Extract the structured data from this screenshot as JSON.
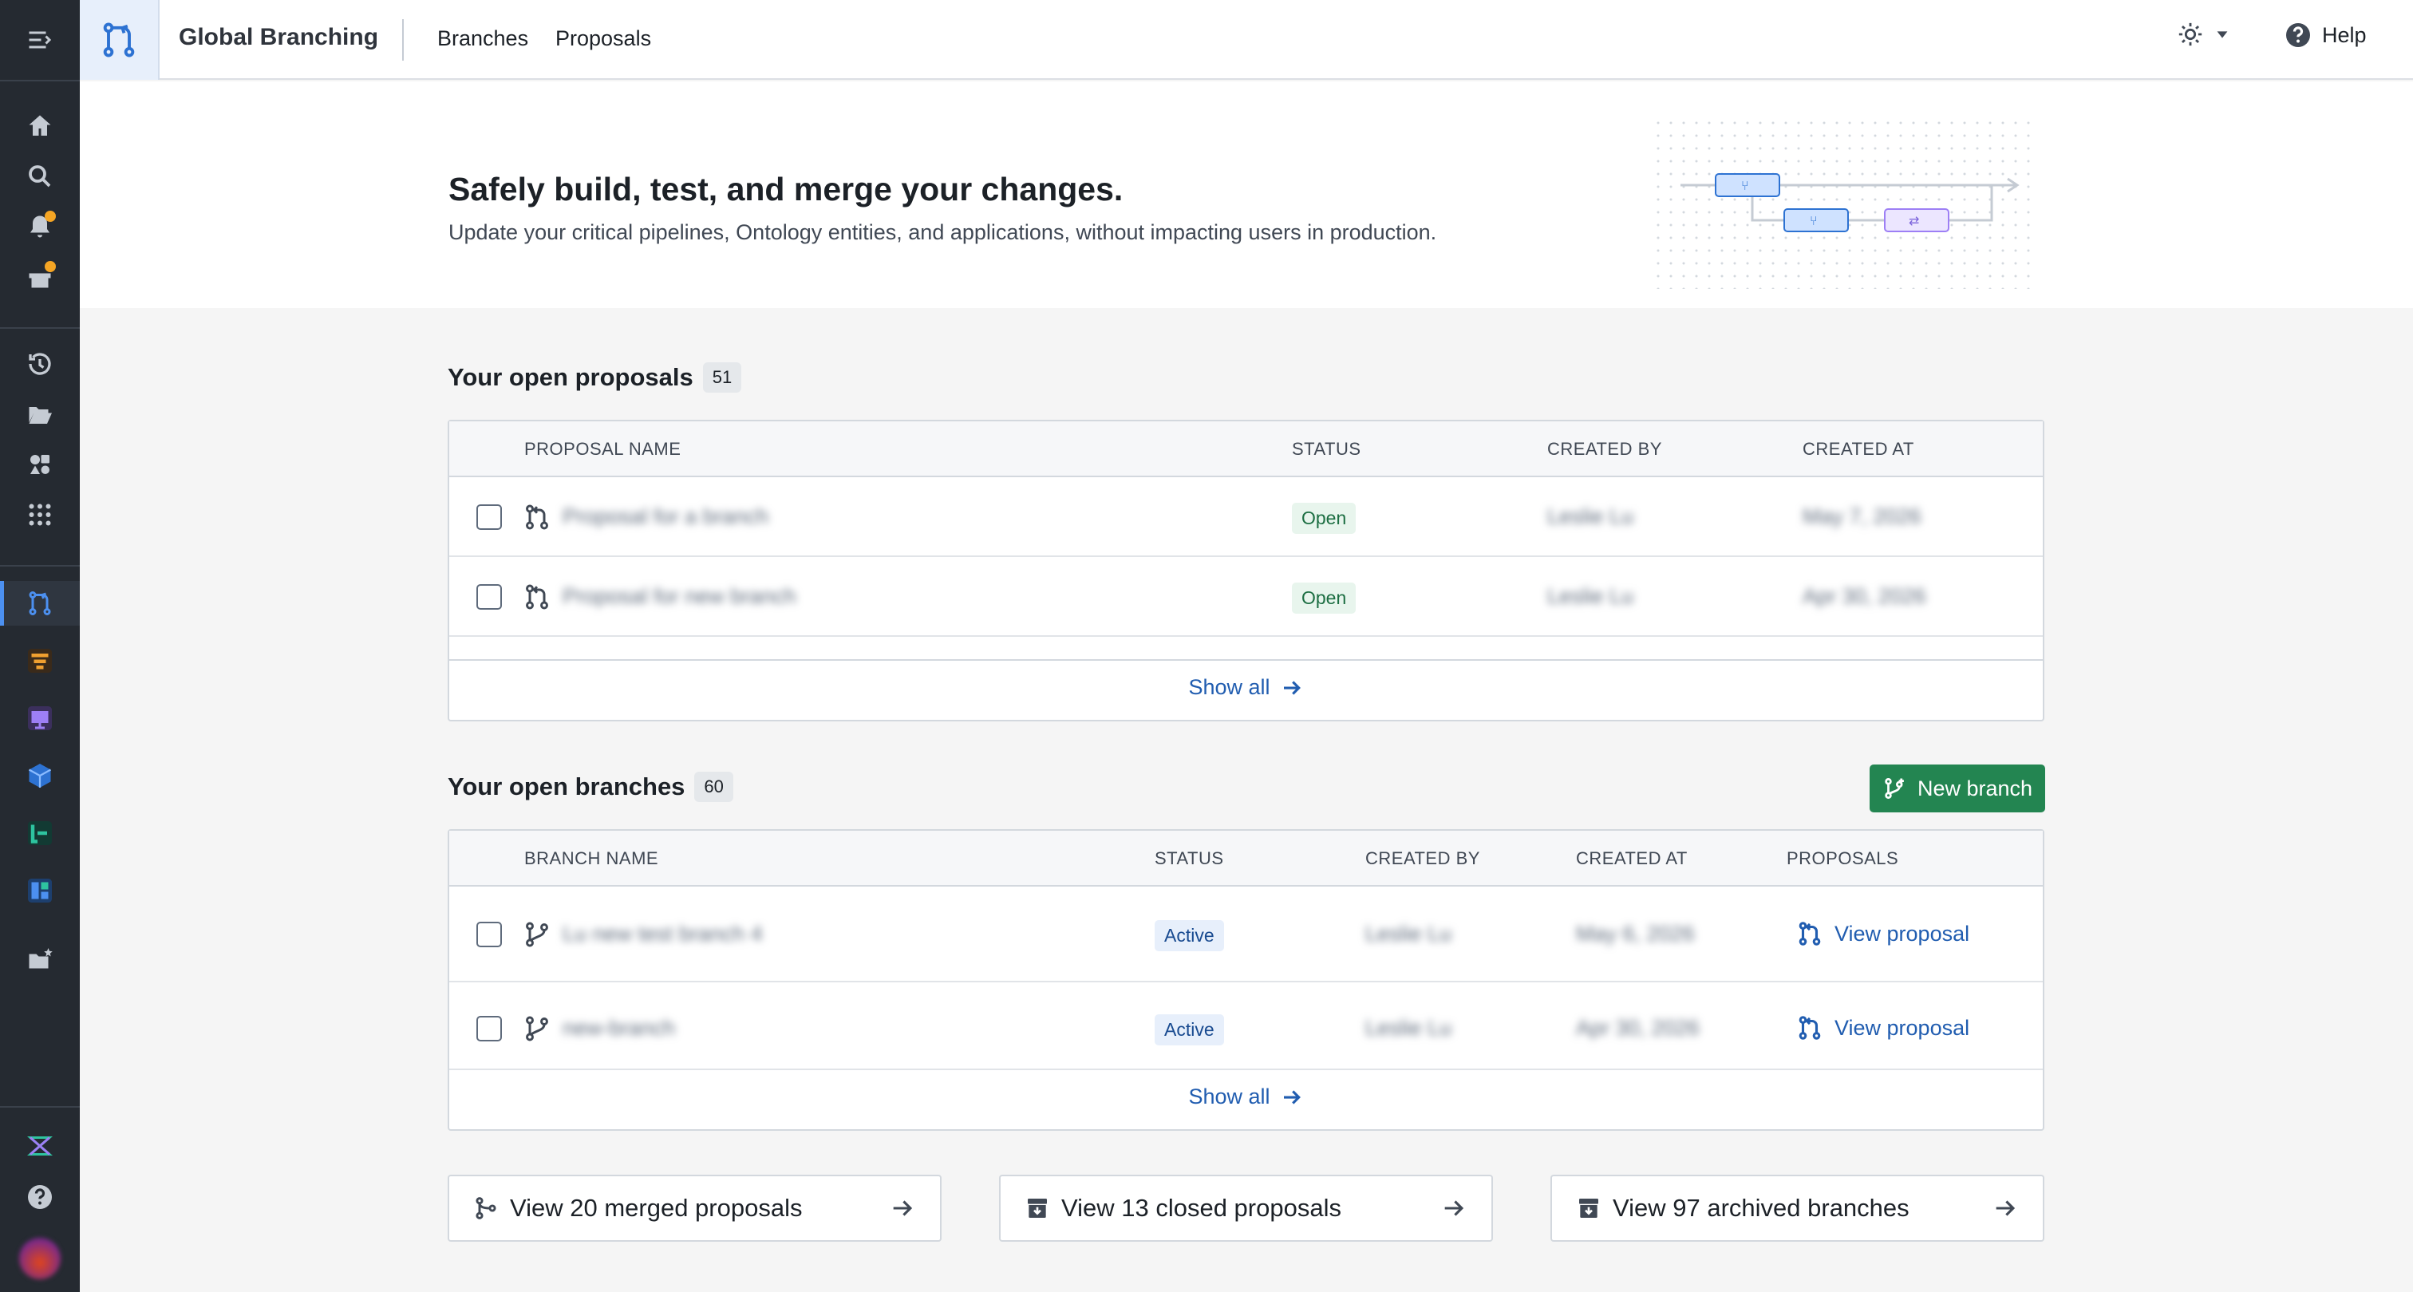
{
  "app": {
    "title": "Global Branching",
    "nav": [
      "Branches",
      "Proposals"
    ],
    "help_label": "Help"
  },
  "hero": {
    "title": "Safely build, test, and merge your changes.",
    "subtitle": "Update your critical pipelines, Ontology entities, and applications, without impacting users in production."
  },
  "proposals": {
    "title": "Your open proposals",
    "count": "51",
    "columns": [
      "PROPOSAL NAME",
      "STATUS",
      "CREATED BY",
      "CREATED AT"
    ],
    "rows": [
      {
        "name": "Proposal for a branch",
        "status": "Open",
        "created_by": "Leslie Lu",
        "created_at": "May 7, 2026"
      },
      {
        "name": "Proposal for new branch",
        "status": "Open",
        "created_by": "Leslie Lu",
        "created_at": "Apr 30, 2026"
      }
    ],
    "show_all": "Show all"
  },
  "branches": {
    "title": "Your open branches",
    "count": "60",
    "new_branch_label": "New branch",
    "columns": [
      "BRANCH NAME",
      "STATUS",
      "CREATED BY",
      "CREATED AT",
      "PROPOSALS"
    ],
    "rows": [
      {
        "name": "Lu new test branch 4",
        "status": "Active",
        "created_by": "Leslie Lu",
        "created_at": "May 6, 2026",
        "proposal_link": "View proposal"
      },
      {
        "name": "new-branch",
        "status": "Active",
        "created_by": "Leslie Lu",
        "created_at": "Apr 30, 2026",
        "proposal_link": "View proposal"
      }
    ],
    "show_all": "Show all"
  },
  "footer_links": [
    {
      "label": "View 20 merged proposals",
      "icon": "merge-icon"
    },
    {
      "label": "View 13 closed proposals",
      "icon": "archive-box-icon"
    },
    {
      "label": "View 97 archived branches",
      "icon": "archive-box-icon"
    }
  ],
  "colors": {
    "rail": "#252a31",
    "primary_link": "#215db0",
    "success": "#238551",
    "notification_dot": "#f5a524"
  }
}
